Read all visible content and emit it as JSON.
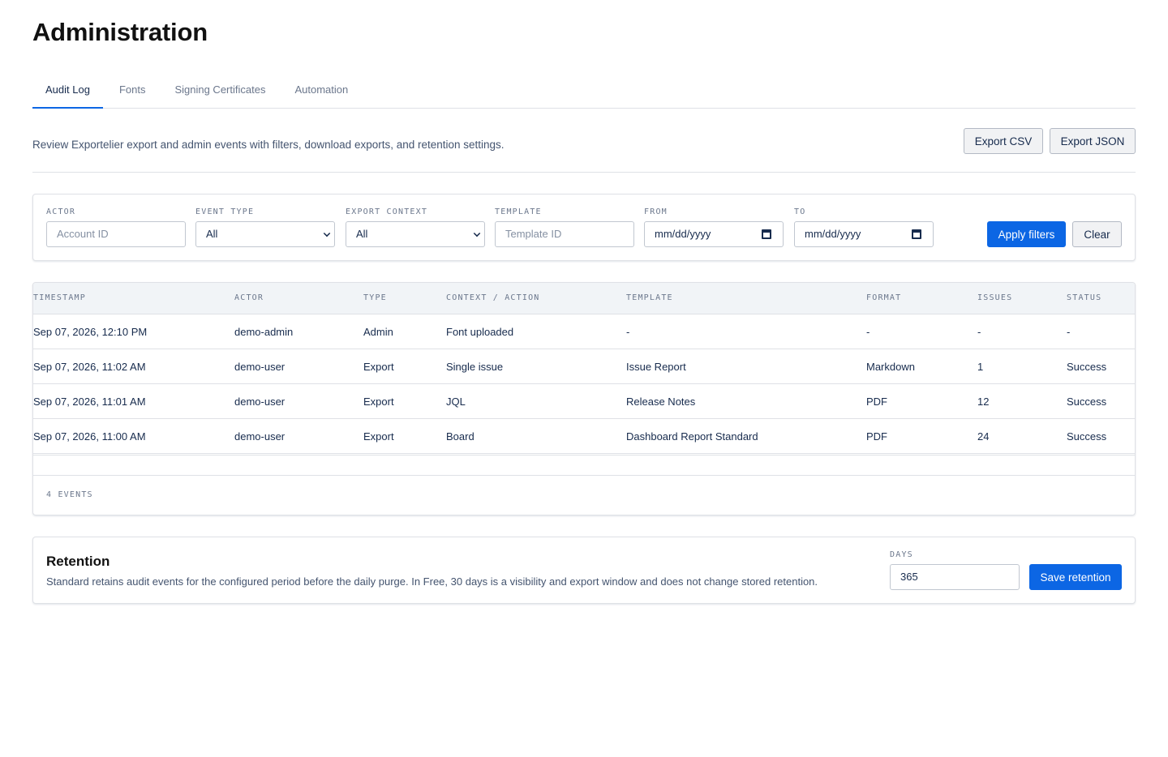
{
  "page": {
    "title": "Administration"
  },
  "tabs": [
    "Audit Log",
    "Fonts",
    "Signing Certificates",
    "Automation"
  ],
  "description": "Review Exportelier export and admin events with filters, download exports, and retention settings.",
  "actions": {
    "export_csv": "Export CSV",
    "export_json": "Export JSON"
  },
  "filters": {
    "actor": {
      "label": "ACTOR",
      "placeholder": "Account ID"
    },
    "event_type": {
      "label": "EVENT TYPE",
      "value": "All"
    },
    "export_context": {
      "label": "EXPORT CONTEXT",
      "value": "All"
    },
    "template": {
      "label": "TEMPLATE",
      "placeholder": "Template ID"
    },
    "from": {
      "label": "FROM",
      "value": "mm/dd/yyyy"
    },
    "to": {
      "label": "TO",
      "value": "mm/dd/yyyy"
    },
    "apply_label": "Apply filters",
    "clear_label": "Clear"
  },
  "table": {
    "columns": [
      "TIMESTAMP",
      "ACTOR",
      "TYPE",
      "CONTEXT / ACTION",
      "TEMPLATE",
      "FORMAT",
      "ISSUES",
      "STATUS"
    ],
    "rows": [
      [
        "Sep 07, 2026, 12:10 PM",
        "demo-admin",
        "Admin",
        "Font uploaded",
        "-",
        "-",
        "-",
        "-"
      ],
      [
        "Sep 07, 2026, 11:02 AM",
        "demo-user",
        "Export",
        "Single issue",
        "Issue Report",
        "Markdown",
        "1",
        "Success"
      ],
      [
        "Sep 07, 2026, 11:01 AM",
        "demo-user",
        "Export",
        "JQL",
        "Release Notes",
        "PDF",
        "12",
        "Success"
      ],
      [
        "Sep 07, 2026, 11:00 AM",
        "demo-user",
        "Export",
        "Board",
        "Dashboard Report Standard",
        "PDF",
        "24",
        "Success"
      ]
    ],
    "event_count": "4 EVENTS"
  },
  "retention": {
    "title": "Retention",
    "text": "Standard retains audit events for the configured period before the daily purge. In Free, 30 days is a visibility and export window and does not change stored retention.",
    "days_label": "DAYS",
    "days_value": "365",
    "save_label": "Save retention"
  },
  "colors": {
    "accent": "#0c66e4",
    "border": "#dfe1e6",
    "header_bg": "#f1f4f7"
  }
}
